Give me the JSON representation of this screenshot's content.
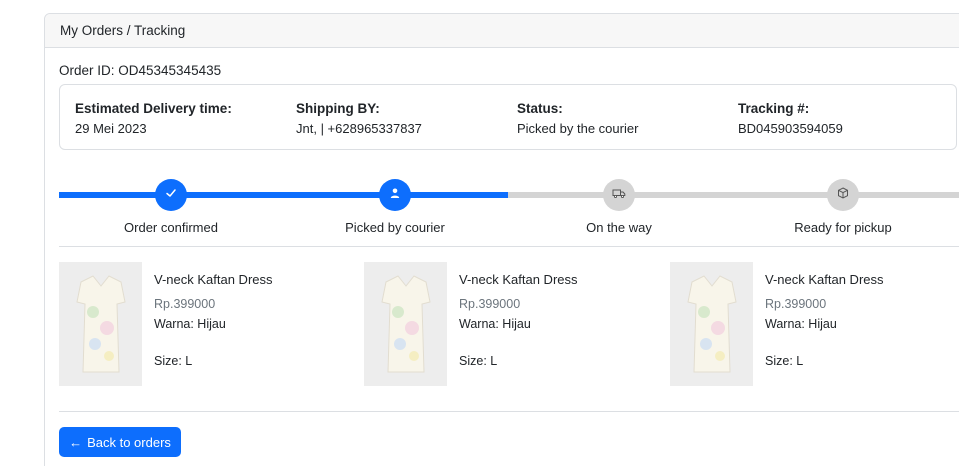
{
  "breadcrumb": "My Orders / Tracking",
  "order": {
    "label": "Order ID: OD45345345435"
  },
  "info": {
    "delivery": {
      "label": "Estimated Delivery time:",
      "value": "29 Mei 2023"
    },
    "shipping": {
      "label": "Shipping BY:",
      "value": "Jnt, | +628965337837"
    },
    "status": {
      "label": "Status:",
      "value": "Picked by the courier"
    },
    "tracking": {
      "label": "Tracking #:",
      "value": "BD045903594059"
    }
  },
  "steps": [
    {
      "label": "Order confirmed",
      "icon": "check-icon",
      "state": "done"
    },
    {
      "label": "Picked by courier",
      "icon": "user-icon",
      "state": "done"
    },
    {
      "label": "On the way",
      "icon": "truck-icon",
      "state": "pending"
    },
    {
      "label": "Ready for pickup",
      "icon": "box-icon",
      "state": "pending"
    }
  ],
  "products": [
    {
      "name": "V-neck Kaftan Dress",
      "price": "Rp.399000",
      "color": "Warna: Hijau",
      "size": "Size: L"
    },
    {
      "name": "V-neck Kaftan Dress",
      "price": "Rp.399000",
      "color": "Warna: Hijau",
      "size": "Size: L"
    },
    {
      "name": "V-neck Kaftan Dress",
      "price": "Rp.399000",
      "color": "Warna: Hijau",
      "size": "Size: L"
    }
  ],
  "back_button": {
    "arrow": "←",
    "label": "Back to orders"
  },
  "colors": {
    "primary": "#0d6efd",
    "pending": "#d4d4d4",
    "header_bg": "#f7f7f7",
    "border": "#dcdfe3"
  }
}
